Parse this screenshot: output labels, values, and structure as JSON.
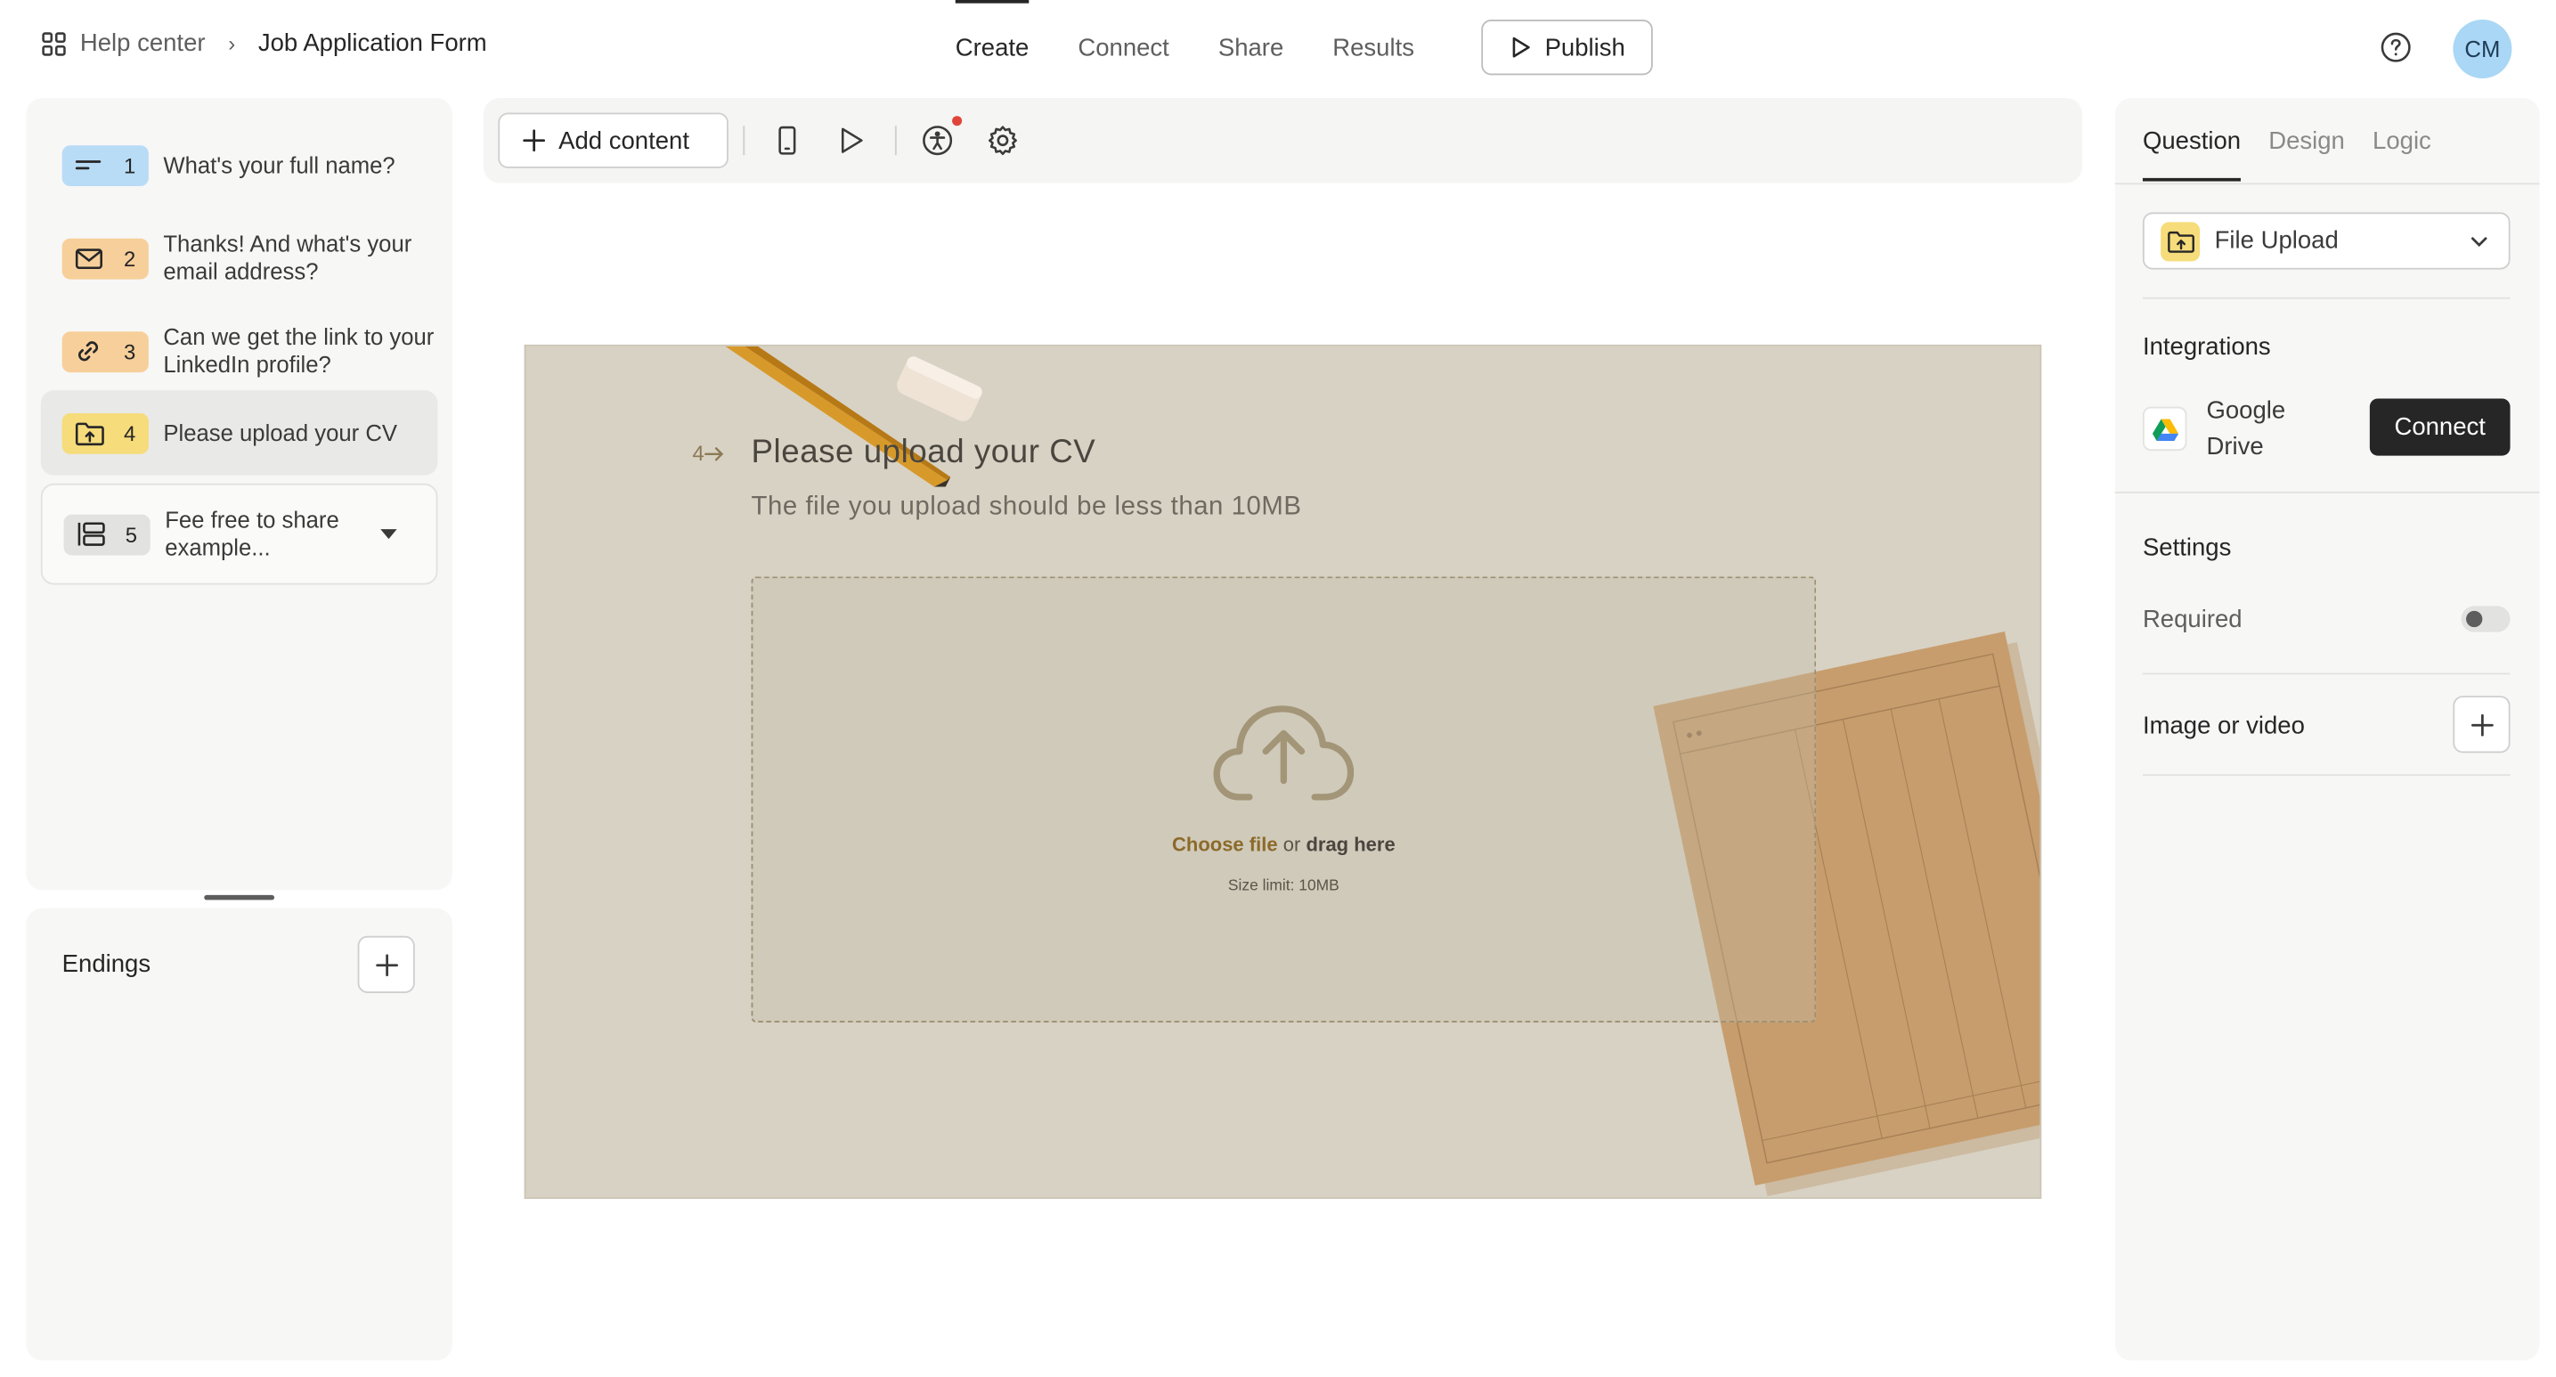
{
  "topbar": {
    "breadcrumb_root": "Help center",
    "breadcrumb_form": "Job Application Form",
    "tabs": [
      "Create",
      "Connect",
      "Share",
      "Results"
    ],
    "active_tab": "Create",
    "publish_label": "Publish",
    "avatar_initials": "CM"
  },
  "questions": [
    {
      "number": "1",
      "text": "What's your full name?",
      "type_icon": "short-text-icon",
      "color": "#b9dcf6"
    },
    {
      "number": "2",
      "text": "Thanks! And what's your email address?",
      "type_icon": "mail-icon",
      "color": "#f7cf9a"
    },
    {
      "number": "3",
      "text": "Can we get the link to your LinkedIn profile?",
      "type_icon": "link-icon",
      "color": "#f7cf9a"
    },
    {
      "number": "4",
      "text": "Please upload your CV",
      "type_icon": "folder-upload-icon",
      "color": "#f6dc7a",
      "active": true
    },
    {
      "number": "5",
      "text": "Fee free to share example...",
      "type_icon": "multiple-choice-icon",
      "color": "#e2e2e0"
    }
  ],
  "endings": {
    "title": "Endings"
  },
  "toolbar": {
    "add_content_label": "Add content"
  },
  "canvas": {
    "question_number": "4",
    "question_title": "Please upload your CV",
    "question_description": "The file you upload should be less than 10MB",
    "choose_file": "Choose file",
    "or_text": "or",
    "drag_here": "drag here",
    "size_limit": "Size limit: 10MB"
  },
  "right_panel": {
    "tabs": [
      "Question",
      "Design",
      "Logic"
    ],
    "active_tab": "Question",
    "question_type": "File Upload",
    "integrations_title": "Integrations",
    "integration_name": "Google Drive",
    "connect_label": "Connect",
    "settings_title": "Settings",
    "required_label": "Required",
    "required_on": false,
    "image_video_label": "Image or video"
  },
  "colors": {
    "canvas_bg": "#d8d2c4",
    "accent_dark": "#262627",
    "avatar_bg": "#a9d7f5"
  }
}
